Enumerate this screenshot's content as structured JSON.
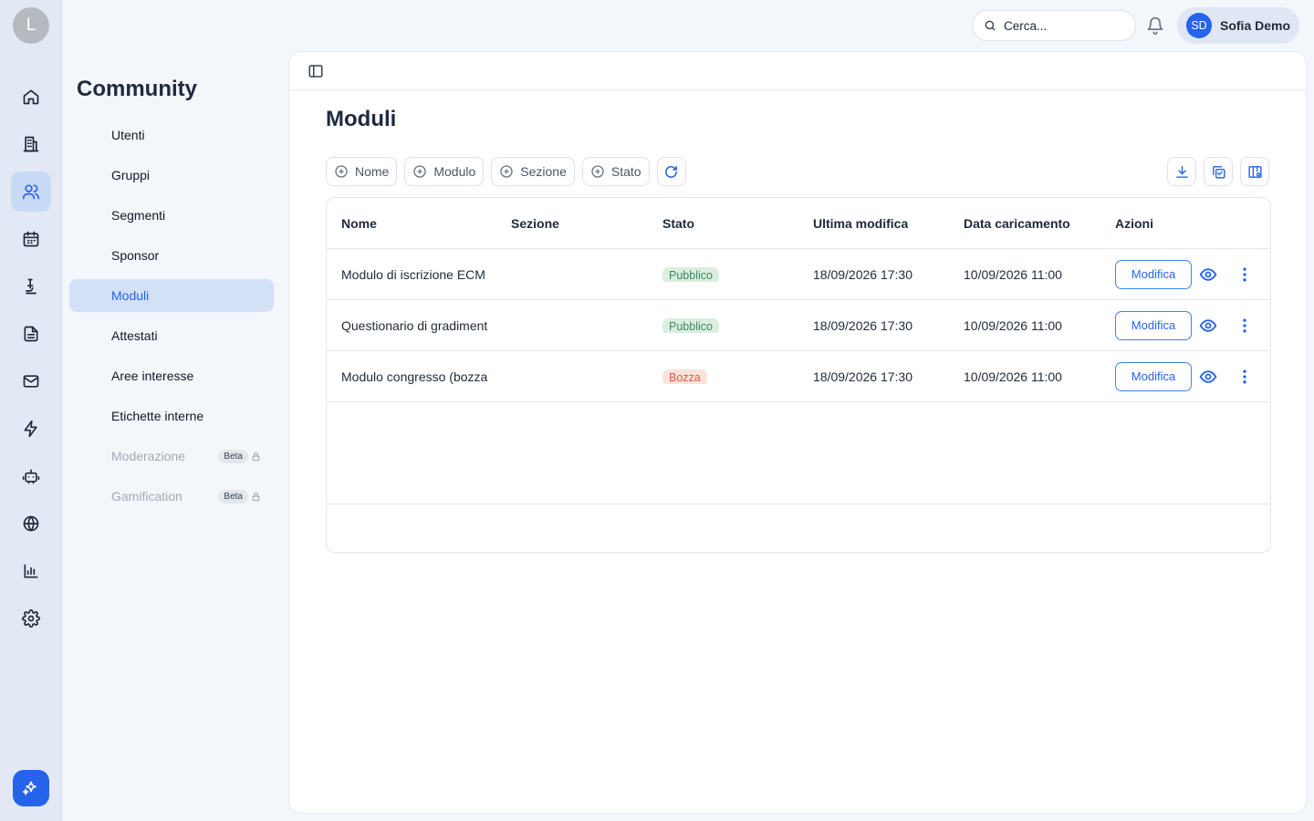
{
  "rail": {
    "logo_letter": "L",
    "items": [
      {
        "name": "home-icon"
      },
      {
        "name": "building-icon"
      },
      {
        "name": "users-icon",
        "active": true
      },
      {
        "name": "calendar-icon"
      },
      {
        "name": "microscope-icon"
      },
      {
        "name": "document-icon"
      },
      {
        "name": "mail-icon"
      },
      {
        "name": "lightning-icon"
      },
      {
        "name": "robot-icon"
      },
      {
        "name": "globe-icon"
      },
      {
        "name": "chart-icon"
      },
      {
        "name": "gear-icon"
      }
    ],
    "ai_button_icon": "sparkles-icon"
  },
  "subnav": {
    "title": "Community",
    "items": [
      {
        "label": "Utenti"
      },
      {
        "label": "Gruppi"
      },
      {
        "label": "Segmenti"
      },
      {
        "label": "Sponsor"
      },
      {
        "label": "Moduli",
        "active": true
      },
      {
        "label": "Attestati"
      },
      {
        "label": "Aree interesse"
      },
      {
        "label": "Etichette interne"
      },
      {
        "label": "Moderazione",
        "badge": "Beta",
        "locked": true
      },
      {
        "label": "Gamification",
        "badge": "Beta",
        "locked": true
      }
    ]
  },
  "topbar": {
    "search_placeholder": "Cerca...",
    "user_initials": "SD",
    "user_name": "Sofia Demo"
  },
  "page": {
    "title": "Moduli",
    "filters": [
      "Nome",
      "Modulo",
      "Sezione",
      "Stato"
    ]
  },
  "table": {
    "headers": {
      "nome": "Nome",
      "sezione": "Sezione",
      "stato": "Stato",
      "ultima": "Ultima modifica",
      "data": "Data caricamento",
      "azioni": "Azioni"
    },
    "rows": [
      {
        "nome": "Modulo di iscrizione ECM",
        "sezione": "",
        "stato": "Pubblico",
        "ultima": "18/09/2026 17:30",
        "data": "10/09/2026 11:00",
        "azione": "Modifica"
      },
      {
        "nome": "Questionario di gradiment",
        "sezione": "",
        "stato": "Pubblico",
        "ultima": "18/09/2026 17:30",
        "data": "10/09/2026 11:00",
        "azione": "Modifica"
      },
      {
        "nome": "Modulo congresso (bozza",
        "sezione": "",
        "stato": "Bozza",
        "ultima": "18/09/2026 17:30",
        "data": "10/09/2026 11:00",
        "azione": "Modifica"
      }
    ]
  },
  "colors": {
    "accent": "#2563eb",
    "published_bg": "#dbeee1",
    "draft_bg": "#fbe3dd"
  }
}
